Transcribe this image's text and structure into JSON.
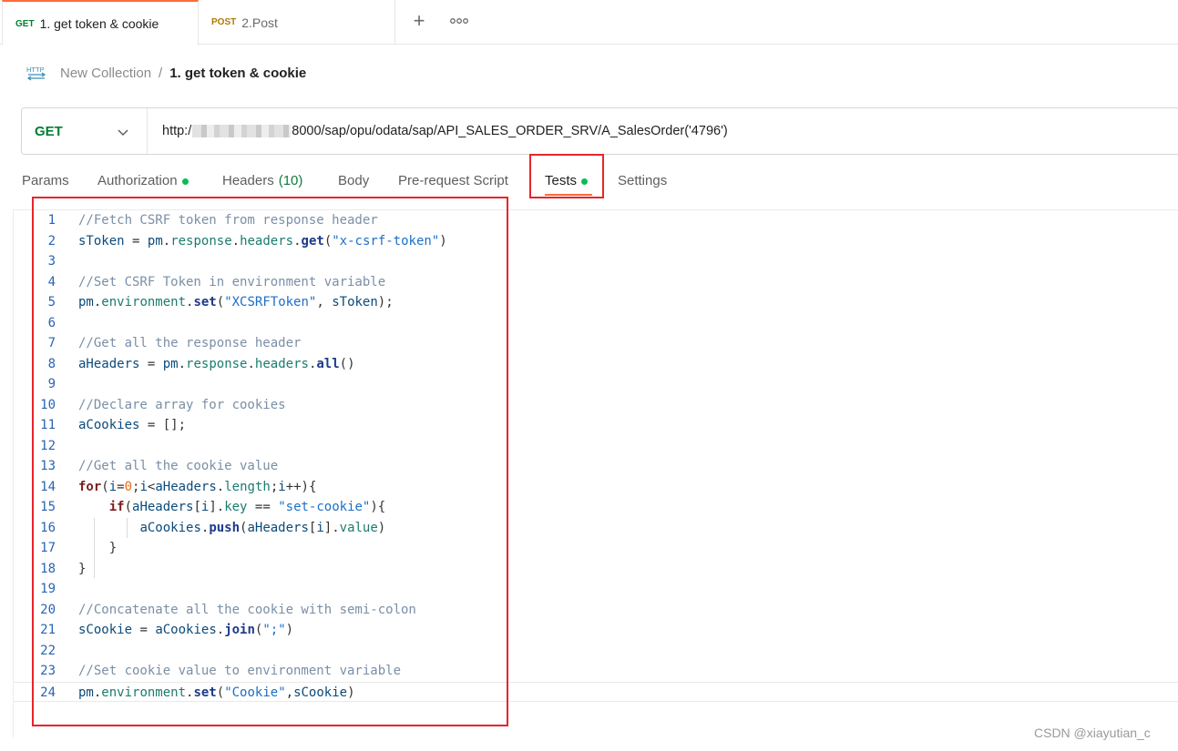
{
  "tabs": [
    {
      "method": "GET",
      "label": "1. get token & cookie"
    },
    {
      "method": "POST",
      "label": "2.Post"
    }
  ],
  "tab_actions": {
    "add": "+",
    "more": "ooo"
  },
  "breadcrumb": {
    "icon_text": "HTTP",
    "collection": "New Collection",
    "separator": "/",
    "request": "1. get token & cookie"
  },
  "request": {
    "method": "GET",
    "url_prefix": "http:/",
    "url_suffix": "8000/sap/opu/odata/sap/API_SALES_ORDER_SRV/A_SalesOrder('4796')"
  },
  "subtabs": {
    "params": "Params",
    "authorization": "Authorization",
    "headers": "Headers",
    "headers_count": "(10)",
    "body": "Body",
    "prerequest": "Pre-request Script",
    "tests": "Tests",
    "settings": "Settings"
  },
  "code_lines": [
    "//Fetch CSRF token from response header",
    "sToken = pm.response.headers.get(\"x-csrf-token\")",
    "",
    "//Set CSRF Token in environment variable",
    "pm.environment.set(\"XCSRFToken\", sToken);",
    "",
    "//Get all the response header",
    "aHeaders = pm.response.headers.all()",
    "",
    "//Declare array for cookies",
    "aCookies = [];",
    "",
    "//Get all the cookie value",
    "for(i=0;i<aHeaders.length;i++){",
    "    if(aHeaders[i].key == \"set-cookie\"){",
    "        aCookies.push(aHeaders[i].value)",
    "    }",
    "}",
    "",
    "//Concatenate all the cookie with semi-colon",
    "sCookie = aCookies.join(\";\")",
    "",
    "//Set cookie value to environment variable",
    "pm.environment.set(\"Cookie\",sCookie)"
  ],
  "watermark": "CSDN @xiayutian_c",
  "colors": {
    "accent": "#ff6c37",
    "get": "#007f31",
    "post": "#ad7a03",
    "dot": "#0cbb52",
    "highlight": "#e8242b"
  }
}
